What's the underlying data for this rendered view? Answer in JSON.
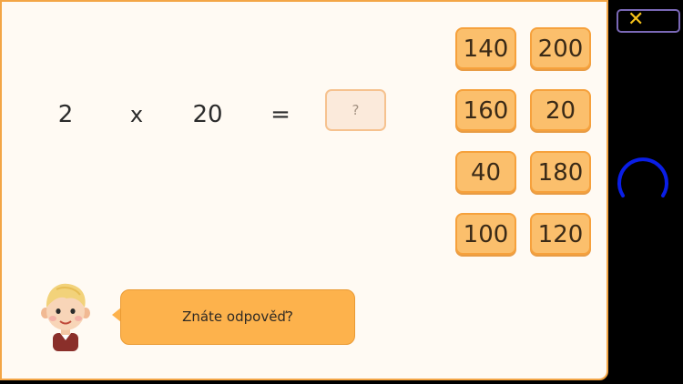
{
  "equation": {
    "operand1": "2",
    "operator": "x",
    "operand2": "20",
    "equals": "=",
    "answer_placeholder": "?"
  },
  "options": [
    "140",
    "200",
    "160",
    "20",
    "40",
    "180",
    "100",
    "120"
  ],
  "speech": {
    "text": "Znáte odpověď?"
  },
  "close_icon": "close-icon",
  "colors": {
    "accent": "#fdb24c",
    "panel_border": "#f3a545",
    "option_bg": "#fbbf6c",
    "spinner": "#0a1ee6",
    "close": "#f6c21a"
  }
}
